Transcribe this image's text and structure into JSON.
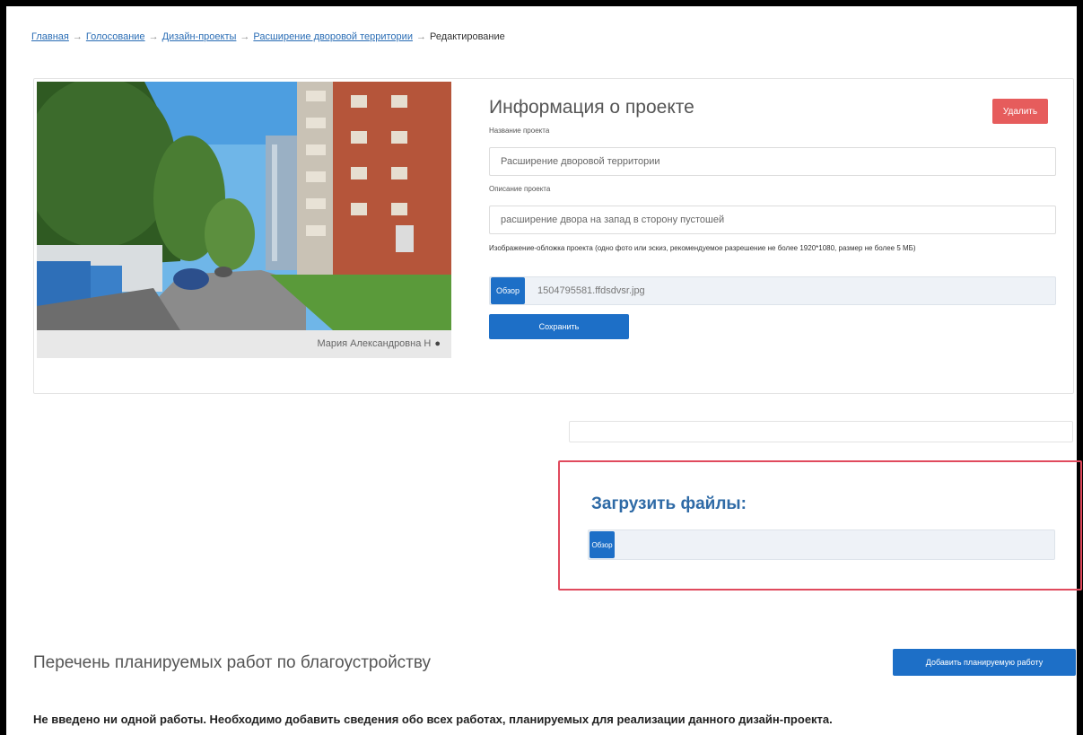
{
  "breadcrumb": {
    "items": [
      "Главная",
      "Голосование",
      "Дизайн-проекты",
      "Расширение дворовой территории"
    ],
    "separator": "→",
    "current": "Редактирование"
  },
  "project": {
    "title": "Информация о проекте",
    "delete_label": "Удалить",
    "name_label": "Название проекта",
    "name_value": "Расширение дворовой территории",
    "description_label": "Описание проекта",
    "description_value": "расширение двора на запад в сторону пустошей",
    "image_hint": "Изображение-обложка проекта (одно фото или эскиз, рекомендуемое разрешение не более 1920*1080, размер не более 5 МБ)",
    "browse_label": "Обзор",
    "selected_file": "1504795581.ffdsdvsr.jpg",
    "save_label": "Сохранить",
    "photo_author": "Мария Александровна Н",
    "photo_author_icon": "person-icon"
  },
  "upload": {
    "title": "Загрузить файлы:",
    "browse_label": "Обзор"
  },
  "works": {
    "title": "Перечень планируемых работ по благоустройству",
    "add_label": "Добавить планируемую работу",
    "empty_message": "Не введено ни одной работы. Необходимо добавить сведения обо всех работах, планируемых для реализации данного дизайн-проекта."
  },
  "colors": {
    "accent": "#1d6fc7",
    "danger": "#e65c5c",
    "highlight": "#e04a5d",
    "link": "#2a6db5"
  }
}
